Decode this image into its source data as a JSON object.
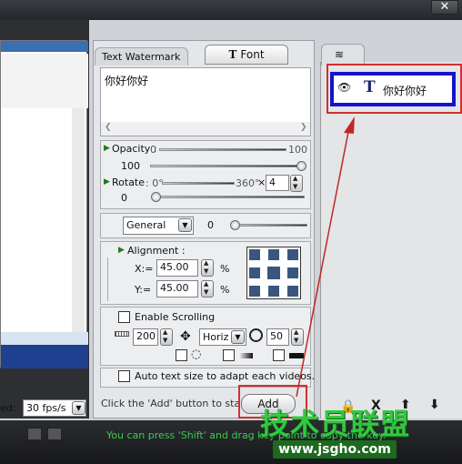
{
  "window": {
    "close_glyph": "✕"
  },
  "left": {
    "speed_label": "ed:",
    "speed_value": "30 fps/s"
  },
  "tabs": {
    "watermark": "Text Watermark",
    "font": "Font",
    "font_glyph": "T"
  },
  "text": {
    "content": "你好你好"
  },
  "opacity": {
    "label": "Opacity :",
    "min": "0",
    "max": "100",
    "value": "100"
  },
  "rotate": {
    "label": "Rotate",
    "min": ": 0°",
    "max": "360°",
    "times": "×",
    "count": "4",
    "value": "0"
  },
  "general": {
    "select": "General",
    "value": "0"
  },
  "alignment": {
    "label": "Alignment :",
    "x_label": "X:=",
    "x_value": "45.00",
    "y_label": "Y:=",
    "y_value": "45.00",
    "pct": "%"
  },
  "scrolling": {
    "label": "Enable Scrolling",
    "speed": "200",
    "direction": "Horiz",
    "delay": "50"
  },
  "auto_size": {
    "label": "Auto text size to adapt each videos."
  },
  "add": {
    "hint": "Click the 'Add' button to start ->",
    "button": "Add"
  },
  "list": {
    "item_text": "你好你好",
    "item_icon": "eye-icon",
    "item_type": "T"
  },
  "tools": {
    "lock": "🔒",
    "delete": "X",
    "up": "⬆",
    "down": "⬇"
  },
  "status": {
    "hint": "You can press 'Shift' and drag key point to copy the key."
  },
  "overlay": {
    "brand": "技术员联盟",
    "url": "www.jsgho.com"
  },
  "colors": {
    "accent_blue": "#1414c8",
    "highlight_red": "#d03030",
    "status_green": "#33d04b"
  }
}
